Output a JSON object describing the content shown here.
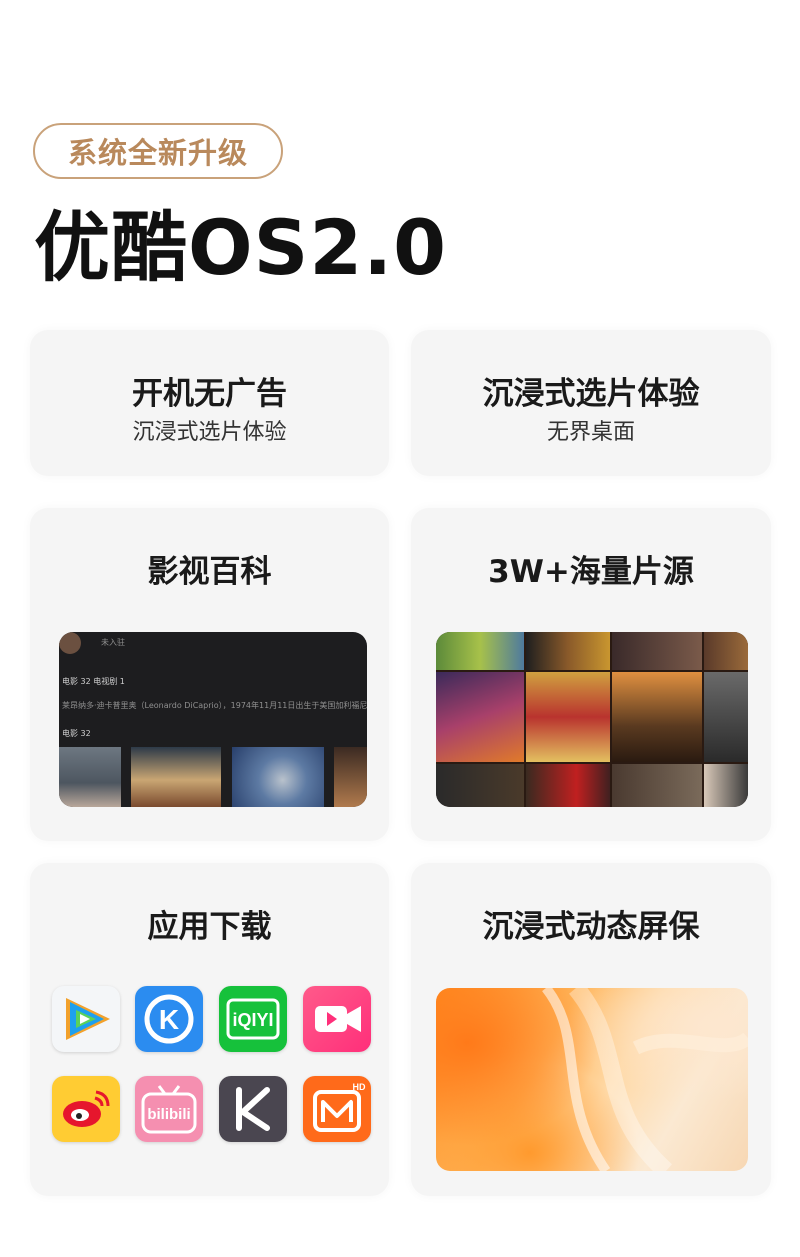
{
  "badge": "系统全新升级",
  "headline": "优酷OS2.0",
  "cards": [
    {
      "title": "开机无广告",
      "subtitle": "沉浸式选片体验"
    },
    {
      "title": "沉浸式选片体验",
      "subtitle": "无界桌面"
    },
    {
      "title": "影视百科"
    },
    {
      "title": "3W+海量片源"
    },
    {
      "title": "应用下载"
    },
    {
      "title": "沉浸式动态屏保"
    }
  ],
  "encyclopedia_shot": {
    "top_text": "未入驻",
    "tabs": "电影 32    电视剧 1",
    "bio": "莱昂纳多·迪卡普里奥（Leonardo DiCaprio），1974年11月11日出生于美国加利福尼亚州洛杉矶，美国影视演员、",
    "section": "电影 32"
  },
  "apps": [
    {
      "name": "tencent-video-icon",
      "color": "#1e90ff"
    },
    {
      "name": "kugou-icon",
      "color": "#2b8cf0"
    },
    {
      "name": "iqiyi-icon",
      "color": "#16c13b"
    },
    {
      "name": "youku-camera-icon",
      "color": "#ff2f7a"
    },
    {
      "name": "weibo-icon",
      "color": "#ffcc33"
    },
    {
      "name": "bilibili-icon",
      "color": "#f58fb0"
    },
    {
      "name": "k-app-icon",
      "color": "#4a4650"
    },
    {
      "name": "mango-tv-icon",
      "color": "#ff6a1a"
    }
  ]
}
